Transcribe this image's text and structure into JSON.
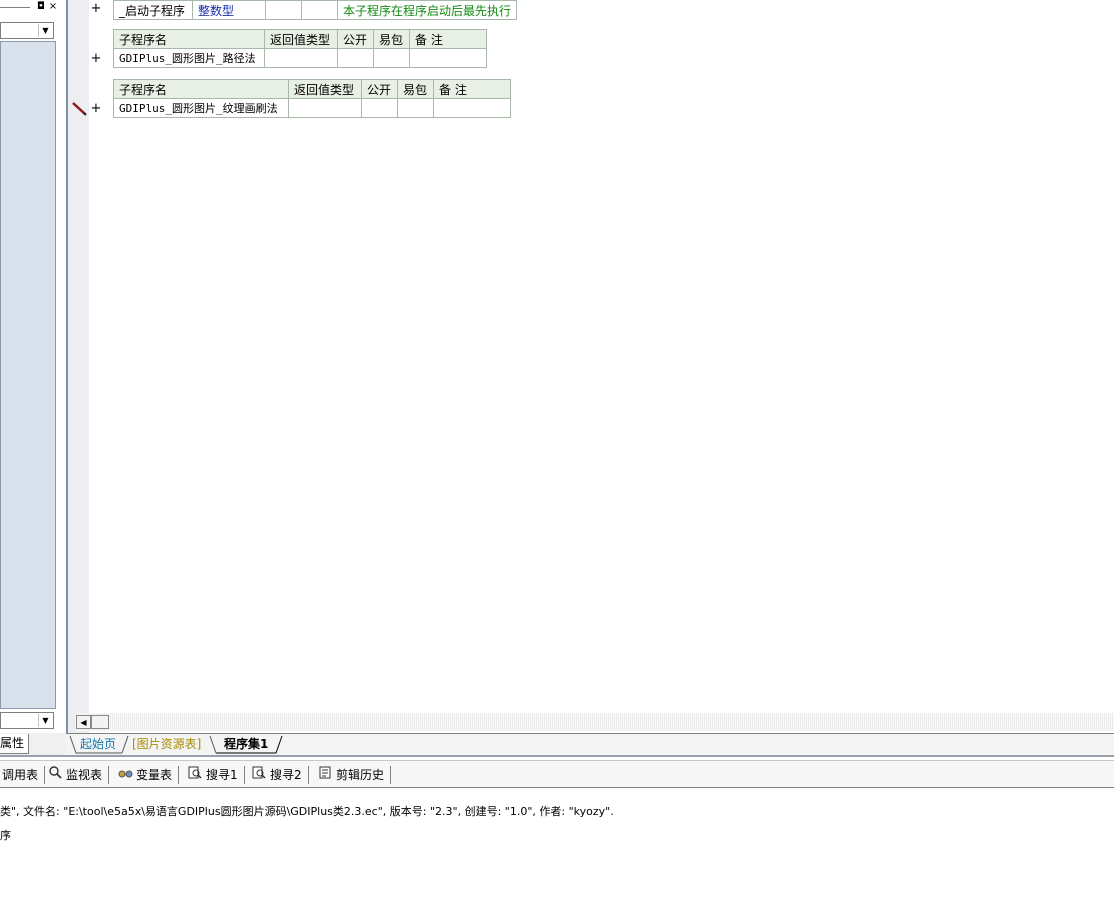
{
  "left_panel": {
    "restore_glyph": "◘",
    "close_glyph": "×",
    "tab_label": "属性"
  },
  "tables": [
    {
      "row": {
        "name": "_启动子程序",
        "return_type": "整数型",
        "comment": "本子程序在程序启动后最先执行"
      }
    },
    {
      "headers": [
        "子程序名",
        "返回值类型",
        "公开",
        "易包",
        "备 注"
      ],
      "row": {
        "name": "GDIPlus_圆形图片_路径法"
      }
    },
    {
      "headers": [
        "子程序名",
        "返回值类型",
        "公开",
        "易包",
        "备 注"
      ],
      "row": {
        "name": "GDIPlus_圆形图片_纹理画刷法"
      }
    }
  ],
  "gutter": {
    "plus_glyph": "+"
  },
  "editor_tabs": [
    {
      "label": "起始页",
      "color": "#1478a8"
    },
    {
      "label": "[图片资源表]",
      "color": "#a38b00"
    },
    {
      "label": "程序集1",
      "color": "#000000",
      "active": true
    }
  ],
  "toolbar": [
    {
      "label": "调用表",
      "icon": ""
    },
    {
      "label": "监视表",
      "icon": "magnifier-icon"
    },
    {
      "label": "变量表",
      "icon": "variables-icon"
    },
    {
      "label": "搜寻1",
      "icon": "search-doc-icon"
    },
    {
      "label": "搜寻2",
      "icon": "search-doc-icon"
    },
    {
      "label": "剪辑历史",
      "icon": "clipboard-icon"
    }
  ],
  "output": {
    "line1": "类\", 文件名: \"E:\\tool\\e5a5x\\易语言GDIPlus圆形图片源码\\GDIPlus类2.3.ec\", 版本号: \"2.3\", 创建号: \"1.0\", 作者: \"kyozy\".",
    "line2": "序"
  }
}
